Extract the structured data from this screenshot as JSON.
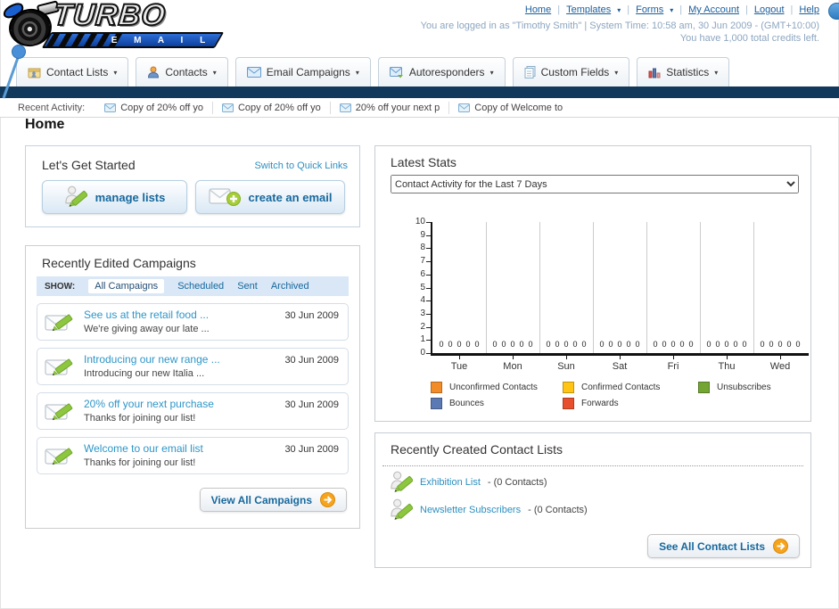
{
  "header": {
    "nav": [
      {
        "label": "Home"
      },
      {
        "label": "Templates"
      },
      {
        "label": "Forms"
      },
      {
        "label": "My Account"
      },
      {
        "label": "Logout"
      },
      {
        "label": "Help"
      }
    ],
    "login_line": "You are logged in as \"Timothy Smith\" | System Time: 10:58 am, 30 Jun 2009 - (GMT+10:00)",
    "credits_line": "You have 1,000 total credits left.",
    "logo_word": "TURBO",
    "logo_sub": "E M A I L"
  },
  "tabs": [
    {
      "label": "Contact Lists"
    },
    {
      "label": "Contacts"
    },
    {
      "label": "Email Campaigns"
    },
    {
      "label": "Autoresponders"
    },
    {
      "label": "Custom Fields"
    },
    {
      "label": "Statistics"
    }
  ],
  "recent_activity": {
    "label": "Recent Activity:",
    "items": [
      {
        "text": "Copy of 20% off yo"
      },
      {
        "text": "Copy of 20% off yo"
      },
      {
        "text": "20% off your next p"
      },
      {
        "text": "Copy of Welcome to"
      }
    ]
  },
  "page_title": "Home",
  "get_started": {
    "title": "Let's Get Started",
    "switch_link": "Switch to Quick Links",
    "manage_lists_label": "manage lists",
    "create_email_label": "create an email"
  },
  "campaigns": {
    "title": "Recently Edited Campaigns",
    "show_label": "SHOW:",
    "filters": [
      {
        "label": "All Campaigns",
        "active": true
      },
      {
        "label": "Scheduled",
        "active": false
      },
      {
        "label": "Sent",
        "active": false
      },
      {
        "label": "Archived",
        "active": false
      }
    ],
    "items": [
      {
        "title": "See us at the retail food ...",
        "subtitle": "We're giving away our late ...",
        "date": "30 Jun 2009"
      },
      {
        "title": "Introducing our new range ...",
        "subtitle": "Introducing our new Italia ...",
        "date": "30 Jun 2009"
      },
      {
        "title": "20% off your next purchase",
        "subtitle": "Thanks for joining our list!",
        "date": "30 Jun 2009"
      },
      {
        "title": "Welcome to our email list",
        "subtitle": "Thanks for joining our list!",
        "date": "30 Jun 2009"
      }
    ],
    "view_all_label": "View All Campaigns"
  },
  "stats": {
    "title": "Latest Stats",
    "dropdown_value": "Contact Activity for the Last 7 Days"
  },
  "chart_data": {
    "type": "bar",
    "title": "Contact Activity for the Last 7 Days",
    "categories": [
      "Tue",
      "Mon",
      "Sun",
      "Sat",
      "Fri",
      "Thu",
      "Wed"
    ],
    "series": [
      {
        "name": "Unconfirmed Contacts",
        "color": "#F28C28",
        "values": [
          0,
          0,
          0,
          0,
          0,
          0,
          0
        ]
      },
      {
        "name": "Confirmed Contacts",
        "color": "#FFC414",
        "values": [
          0,
          0,
          0,
          0,
          0,
          0,
          0
        ]
      },
      {
        "name": "Unsubscribes",
        "color": "#73A533",
        "values": [
          0,
          0,
          0,
          0,
          0,
          0,
          0
        ]
      },
      {
        "name": "Bounces",
        "color": "#5B79B2",
        "values": [
          0,
          0,
          0,
          0,
          0,
          0,
          0
        ]
      },
      {
        "name": "Forwards",
        "color": "#E8502D",
        "values": [
          0,
          0,
          0,
          0,
          0,
          0,
          0
        ]
      }
    ],
    "xlabel": "",
    "ylabel": "",
    "ylim": [
      0,
      10
    ],
    "yticks": [
      0,
      1,
      2,
      3,
      4,
      5,
      6,
      7,
      8,
      9,
      10
    ],
    "grid": "vertical-group-separators",
    "legend_position": "bottom",
    "value_labels_shown": true
  },
  "contact_lists": {
    "title": "Recently Created Contact Lists",
    "items": [
      {
        "name": "Exhibition List",
        "suffix": "- (0 Contacts)"
      },
      {
        "name": "Newsletter Subscribers",
        "suffix": "- (0 Contacts)"
      }
    ],
    "see_all_label": "See All Contact Lists"
  },
  "colors": {
    "navbar_dark": "#12395C",
    "link_blue": "#1C5E9C",
    "item_link_blue": "#2E96C8",
    "button_text_blue": "#17689D",
    "login_text": "#8CA6C0",
    "filter_bar_bg": "#D9E7F6",
    "logo_bar_blue": "#0B3F9E",
    "arrow_button_orange": "#F6A41D"
  }
}
